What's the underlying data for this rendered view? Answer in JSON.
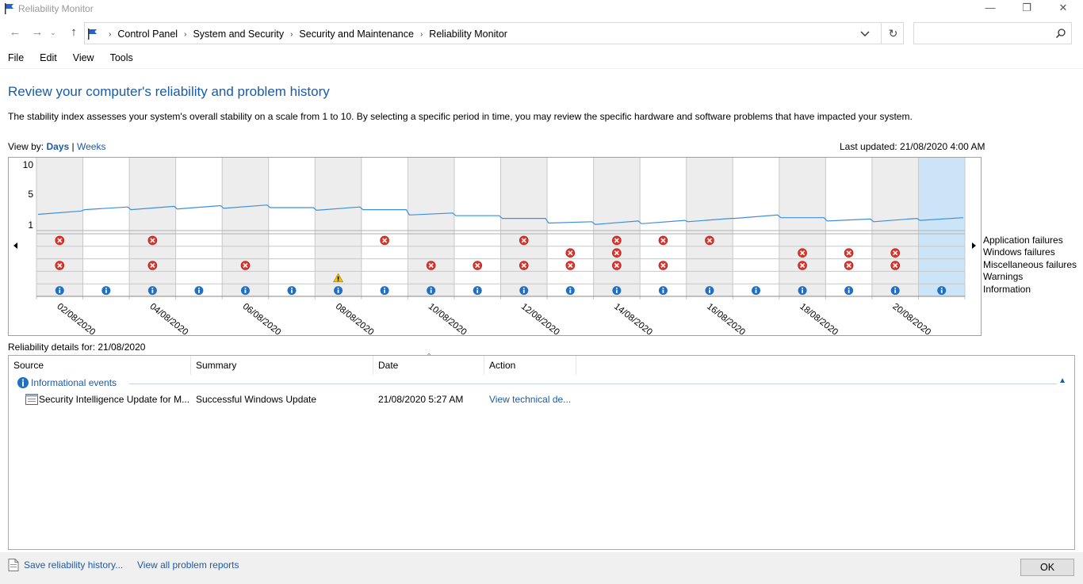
{
  "window": {
    "title": "Reliability Monitor"
  },
  "address": {
    "crumbs": [
      "Control Panel",
      "System and Security",
      "Security and Maintenance",
      "Reliability Monitor"
    ],
    "search_placeholder": ""
  },
  "menu": [
    "File",
    "Edit",
    "View",
    "Tools"
  ],
  "page": {
    "heading": "Review your computer's reliability and problem history",
    "description": "The stability index assesses your system's overall stability on a scale from 1 to 10. By selecting a specific period in time, you may review the specific hardware and software problems that have impacted your system.",
    "view_by_label": "View by:",
    "view_days": "Days",
    "view_sep": "|",
    "view_weeks": "Weeks",
    "last_updated": "Last updated: 21/08/2020 4:00 AM"
  },
  "chart": {
    "y_ticks": [
      "10",
      "5",
      "1"
    ],
    "legend": [
      "Application failures",
      "Windows failures",
      "Miscellaneous failures",
      "Warnings",
      "Information"
    ],
    "date_labels": [
      "02/08/2020",
      "04/08/2020",
      "06/08/2020",
      "08/08/2020",
      "10/08/2020",
      "12/08/2020",
      "14/08/2020",
      "16/08/2020",
      "18/08/2020",
      "20/08/2020"
    ],
    "column_count": 20,
    "selected_column": 19,
    "shaded_columns": [
      0,
      2,
      4,
      6,
      8,
      10,
      12,
      14,
      16,
      18
    ],
    "stability_index": [
      2.6,
      3.3,
      3.3,
      3.4,
      3.5,
      3.6,
      3.2,
      3.3,
      2.5,
      2.4,
      2.0,
      1.3,
      1.1,
      1.2,
      1.5,
      2.0,
      2.1,
      1.6,
      1.5,
      1.7
    ],
    "events": {
      "app_failures": [
        0,
        2,
        7,
        10,
        12,
        13,
        14
      ],
      "windows_failures": [
        11,
        12,
        16,
        17,
        18
      ],
      "misc_failures": [
        0,
        2,
        4,
        8,
        9,
        10,
        11,
        12,
        13,
        16,
        17,
        18
      ],
      "warnings": [
        6
      ],
      "information": [
        0,
        1,
        2,
        3,
        4,
        5,
        6,
        7,
        8,
        9,
        10,
        11,
        12,
        13,
        14,
        15,
        16,
        17,
        18,
        19
      ]
    },
    "colors": {
      "line": "#3f8fd8",
      "shade": "#ededed",
      "selected": "#cce4f7",
      "error": "#e0342b",
      "info": "#1f6fc2",
      "warning": "#f6c500"
    }
  },
  "details": {
    "label": "Reliability details for: 21/08/2020",
    "columns": [
      "Source",
      "Summary",
      "Date",
      "Action"
    ],
    "group": "Informational events",
    "rows": [
      {
        "source": "Security Intelligence Update for M...",
        "summary": "Successful Windows Update",
        "date": "21/08/2020 5:27 AM",
        "action": "View technical de..."
      }
    ]
  },
  "footer": {
    "save": "Save reliability history...",
    "view_all": "View all problem reports",
    "ok": "OK"
  }
}
